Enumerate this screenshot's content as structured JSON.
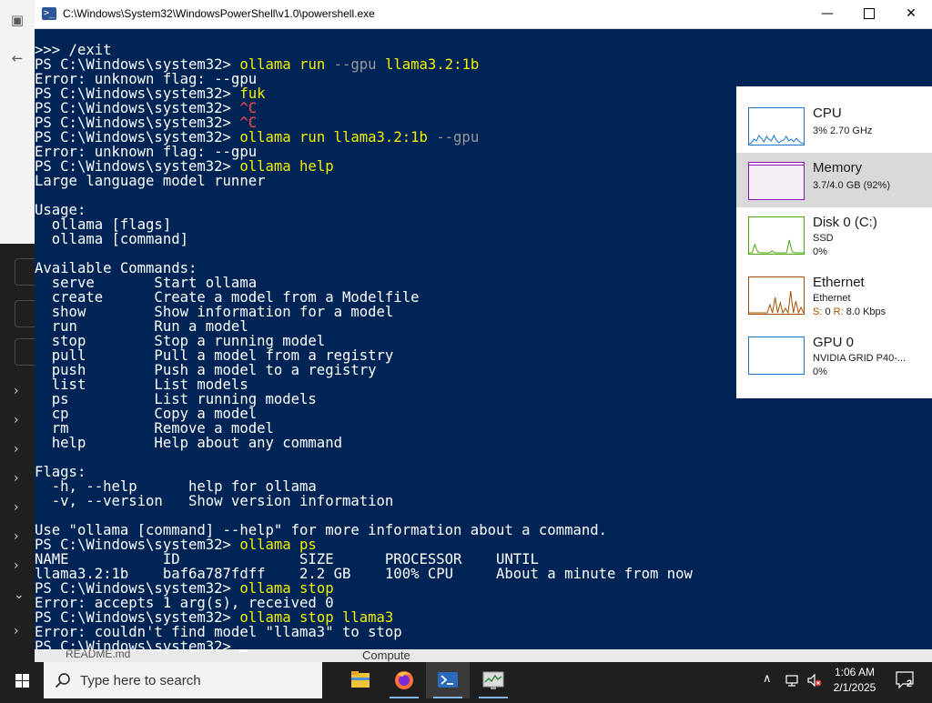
{
  "window": {
    "title": "C:\\Windows\\System32\\WindowsPowerShell\\v1.0\\powershell.exe",
    "minimize": "—",
    "close": "✕"
  },
  "console_lines": [
    [
      {
        "t": ">>> /exit"
      }
    ],
    [
      {
        "t": "PS C:\\Windows\\system32> "
      },
      {
        "t": "ollama",
        "c": "y"
      },
      {
        "t": " run ",
        "c": "y"
      },
      {
        "t": "--gpu",
        "c": "g"
      },
      {
        "t": " llama3.2:1b",
        "c": "y"
      }
    ],
    [
      {
        "t": "Error: unknown flag: --gpu"
      }
    ],
    [
      {
        "t": "PS C:\\Windows\\system32> "
      },
      {
        "t": "fuk",
        "c": "y"
      }
    ],
    [
      {
        "t": "PS C:\\Windows\\system32> "
      },
      {
        "t": "^C",
        "c": "r"
      }
    ],
    [
      {
        "t": "PS C:\\Windows\\system32> "
      },
      {
        "t": "^C",
        "c": "r"
      }
    ],
    [
      {
        "t": "PS C:\\Windows\\system32> "
      },
      {
        "t": "ollama run llama3.2:1b ",
        "c": "y"
      },
      {
        "t": "--gpu",
        "c": "g"
      }
    ],
    [
      {
        "t": "Error: unknown flag: --gpu"
      }
    ],
    [
      {
        "t": "PS C:\\Windows\\system32> "
      },
      {
        "t": "ollama help",
        "c": "y"
      }
    ],
    [
      {
        "t": "Large language model runner"
      }
    ],
    [
      {
        "t": ""
      }
    ],
    [
      {
        "t": "Usage:"
      }
    ],
    [
      {
        "t": "  ollama [flags]"
      }
    ],
    [
      {
        "t": "  ollama [command]"
      }
    ],
    [
      {
        "t": ""
      }
    ],
    [
      {
        "t": "Available Commands:"
      }
    ],
    [
      {
        "t": "  serve       Start ollama"
      }
    ],
    [
      {
        "t": "  create      Create a model from a Modelfile"
      }
    ],
    [
      {
        "t": "  show        Show information for a model"
      }
    ],
    [
      {
        "t": "  run         Run a model"
      }
    ],
    [
      {
        "t": "  stop        Stop a running model"
      }
    ],
    [
      {
        "t": "  pull        Pull a model from a registry"
      }
    ],
    [
      {
        "t": "  push        Push a model to a registry"
      }
    ],
    [
      {
        "t": "  list        List models"
      }
    ],
    [
      {
        "t": "  ps          List running models"
      }
    ],
    [
      {
        "t": "  cp          Copy a model"
      }
    ],
    [
      {
        "t": "  rm          Remove a model"
      }
    ],
    [
      {
        "t": "  help        Help about any command"
      }
    ],
    [
      {
        "t": ""
      }
    ],
    [
      {
        "t": "Flags:"
      }
    ],
    [
      {
        "t": "  -h, --help      help for ollama"
      }
    ],
    [
      {
        "t": "  -v, --version   Show version information"
      }
    ],
    [
      {
        "t": ""
      }
    ],
    [
      {
        "t": "Use \"ollama [command] --help\" for more information about a command."
      }
    ],
    [
      {
        "t": "PS C:\\Windows\\system32> "
      },
      {
        "t": "ollama ps",
        "c": "y"
      }
    ],
    [
      {
        "t": "NAME           ID              SIZE      PROCESSOR    UNTIL"
      }
    ],
    [
      {
        "t": "llama3.2:1b    baf6a787fdff    2.2 GB    100% CPU     About a minute from now"
      }
    ],
    [
      {
        "t": "PS C:\\Windows\\system32> "
      },
      {
        "t": "ollama stop",
        "c": "y"
      }
    ],
    [
      {
        "t": "Error: accepts 1 arg(s), received 0"
      }
    ],
    [
      {
        "t": "PS C:\\Windows\\system32> "
      },
      {
        "t": "ollama stop llama3",
        "c": "y"
      }
    ],
    [
      {
        "t": "Error: couldn't find model \"llama3\" to stop"
      }
    ],
    [
      {
        "t": "PS C:\\Windows\\system32> "
      }
    ]
  ],
  "perf": {
    "cpu": {
      "name": "CPU",
      "line1": "3% 2.70 GHz",
      "color": "#1874cd"
    },
    "memory": {
      "name": "Memory",
      "line1": "3.7/4.0 GB (92%)",
      "color": "#8b12ae",
      "fill_fraction": 0.92
    },
    "disk": {
      "name": "Disk 0 (C:)",
      "line1": "SSD",
      "line2": "0%",
      "color": "#4da60c"
    },
    "ethernet": {
      "name": "Ethernet",
      "line1": "Ethernet",
      "send_label": "S:",
      "send_value": "0",
      "recv_label": "R:",
      "recv_value": "8.0 Kbps",
      "color": "#a74f01"
    },
    "gpu": {
      "name": "GPU 0",
      "line1": "NVIDIA GRID P40-...",
      "line2": "0%",
      "color": "#1874cd"
    }
  },
  "background": {
    "compute_label": "Compute",
    "readme_label": "README.md"
  },
  "taskbar": {
    "search_placeholder": "Type here to search",
    "time": "1:06 AM",
    "date": "2/1/2025",
    "notification_count": "2"
  }
}
